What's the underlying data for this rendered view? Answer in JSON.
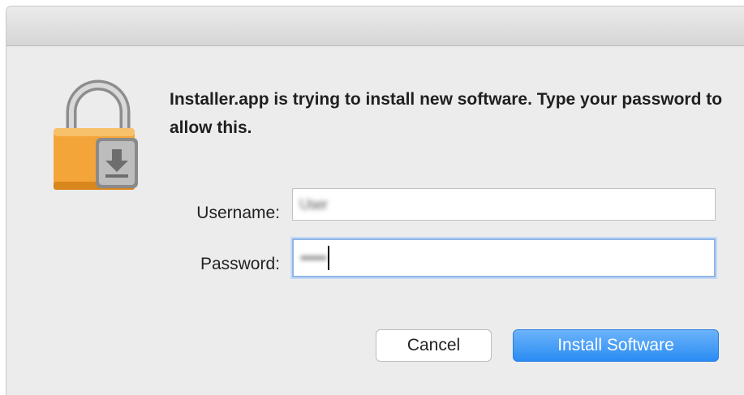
{
  "dialog": {
    "message": "Installer.app is trying to install new software. Type your password to allow this.",
    "lock_icon": "lock-with-download-icon"
  },
  "form": {
    "username_label": "Username:",
    "username_value": "User",
    "password_label": "Password:",
    "password_value": "••••••"
  },
  "buttons": {
    "cancel_label": "Cancel",
    "install_label": "Install Software"
  },
  "colors": {
    "accent": "#2a8cf3",
    "lock_orange": "#f3a53a"
  }
}
